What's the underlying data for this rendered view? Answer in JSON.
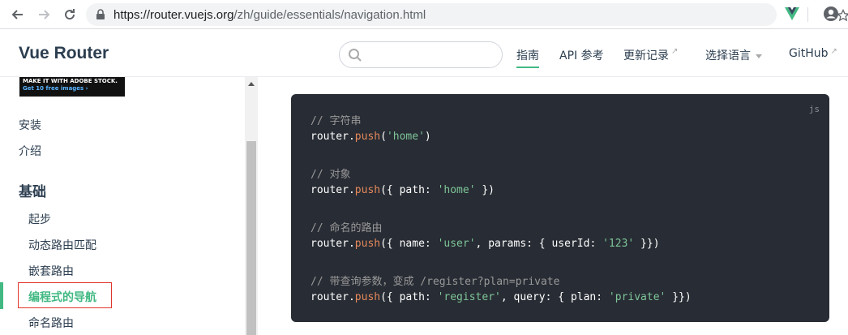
{
  "browser": {
    "url_host": "https://router.vuejs.org",
    "url_path": "/zh/guide/essentials/navigation.html"
  },
  "navbar": {
    "brand": "Vue Router",
    "search_placeholder": "",
    "links": [
      {
        "label": "指南",
        "active": true
      },
      {
        "label": "API 参考"
      },
      {
        "label": "更新记录"
      },
      {
        "label": "选择语言"
      },
      {
        "label": "GitHub"
      }
    ]
  },
  "sidebar": {
    "ad_line1": "MAKE IT WITH ADOBE STOCK.",
    "ad_line2": "Get 10 free images ›",
    "top_links": [
      "安装",
      "介绍"
    ],
    "section_title": "基础",
    "items": [
      "起步",
      "动态路由匹配",
      "嵌套路由",
      "编程式的导航",
      "命名路由"
    ],
    "active_index": 3
  },
  "code": {
    "language": "js",
    "comments": [
      "// 字符串",
      "// 对象",
      "// 命名的路由",
      "// 带查询参数，变成 /register?plan=private"
    ],
    "obj": "router",
    "method": "push",
    "strings": [
      "'home'",
      "'home'",
      "'user'",
      "'123'",
      "'register'",
      "'private'"
    ],
    "keys": {
      "path": "path",
      "name": "name",
      "params": "params",
      "userId": "userId",
      "query": "query",
      "plan": "plan"
    }
  },
  "colors": {
    "accent": "#42b983",
    "code_bg": "#282c34",
    "highlight_border": "#e0352b"
  }
}
